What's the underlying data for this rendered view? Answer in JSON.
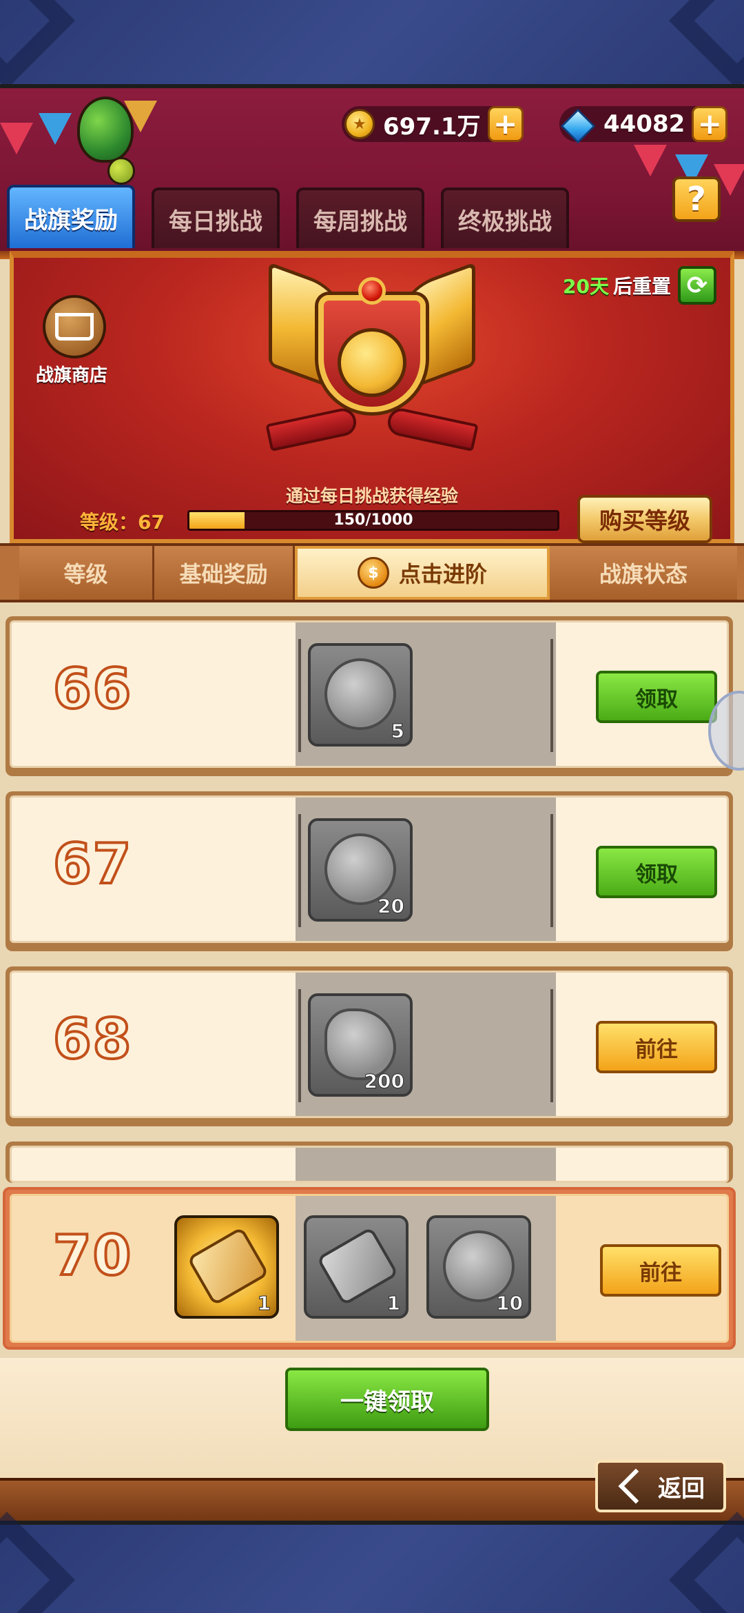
{
  "header": {
    "coins": "697.1万",
    "gems": "44082",
    "help_symbol": "?"
  },
  "tabs": [
    {
      "label": "战旗奖励",
      "active": true
    },
    {
      "label": "每日挑战",
      "active": false
    },
    {
      "label": "每周挑战",
      "active": false
    },
    {
      "label": "终极挑战",
      "active": false
    }
  ],
  "banner": {
    "shop_label": "战旗商店",
    "reset_days": "20天",
    "reset_text": "后重置",
    "exp_hint": "通过每日挑战获得经验",
    "level_label": "等级：67",
    "progress_text": "150/1000",
    "progress_fraction": 0.15,
    "buy_label": "购买等级"
  },
  "columns": {
    "level": "等级",
    "basic": "基础奖励",
    "advance": "点击进阶",
    "status": "战旗状态"
  },
  "rows": [
    {
      "level": "66",
      "item_icon": "silver-coin-icon",
      "count": "5",
      "button": "领取",
      "button_type": "claim"
    },
    {
      "level": "67",
      "item_icon": "eagle-emblem-icon",
      "count": "20",
      "button": "领取",
      "button_type": "claim"
    },
    {
      "level": "68",
      "item_icon": "leaf-stone-icon",
      "count": "200",
      "button": "前往",
      "button_type": "go"
    }
  ],
  "highlight_row": {
    "level": "70",
    "basic_count": "1",
    "adv_counts": [
      "1",
      "10"
    ],
    "button": "前往"
  },
  "footer": {
    "claim_all": "一键领取",
    "back": "返回"
  },
  "colors": {
    "header_bg": "#8c1c3e",
    "claim_green": "#4aab16",
    "go_gold": "#f3a319",
    "tab_active_blue": "#1f6ed4"
  }
}
